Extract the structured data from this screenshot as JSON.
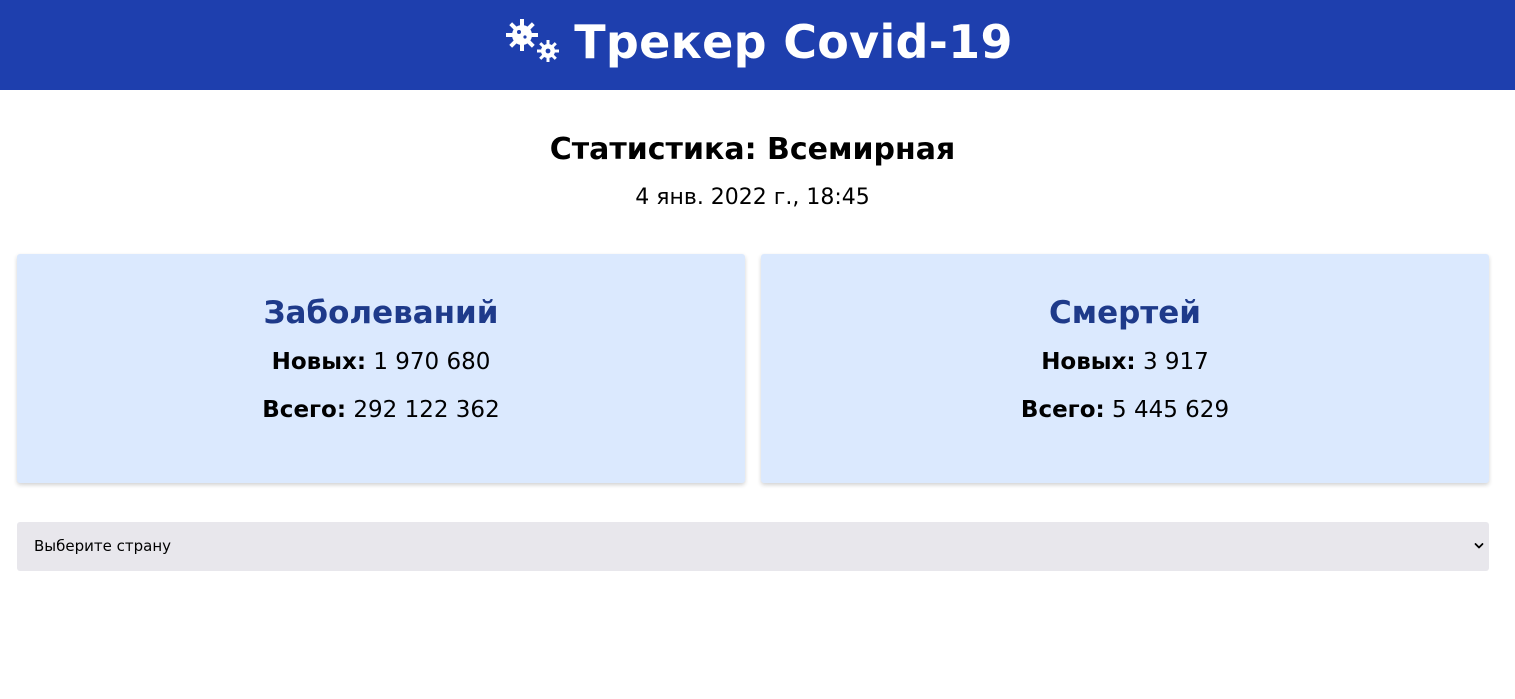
{
  "header": {
    "title": "Трекер Covid-19",
    "icon": "virus-gears-icon",
    "background": "#1e3fae"
  },
  "stats": {
    "title": "Статистика: Всемирная",
    "date": "4 янв. 2022 г., 18:45"
  },
  "cards": {
    "cases": {
      "title": "Заболеваний",
      "new_label": "Новых:",
      "new_value": "1 970 680",
      "total_label": "Всего:",
      "total_value": "292 122 362"
    },
    "deaths": {
      "title": "Смертей",
      "new_label": "Новых:",
      "new_value": "3 917",
      "total_label": "Всего:",
      "total_value": "5 445 629"
    }
  },
  "country_select": {
    "selected": "Выберите страну",
    "icon": "chevron-down-icon"
  },
  "colors": {
    "header_bg": "#1e3fae",
    "card_bg": "#dbe9fe",
    "card_title": "#1e3a8a",
    "select_bg": "#e8e7ec"
  }
}
